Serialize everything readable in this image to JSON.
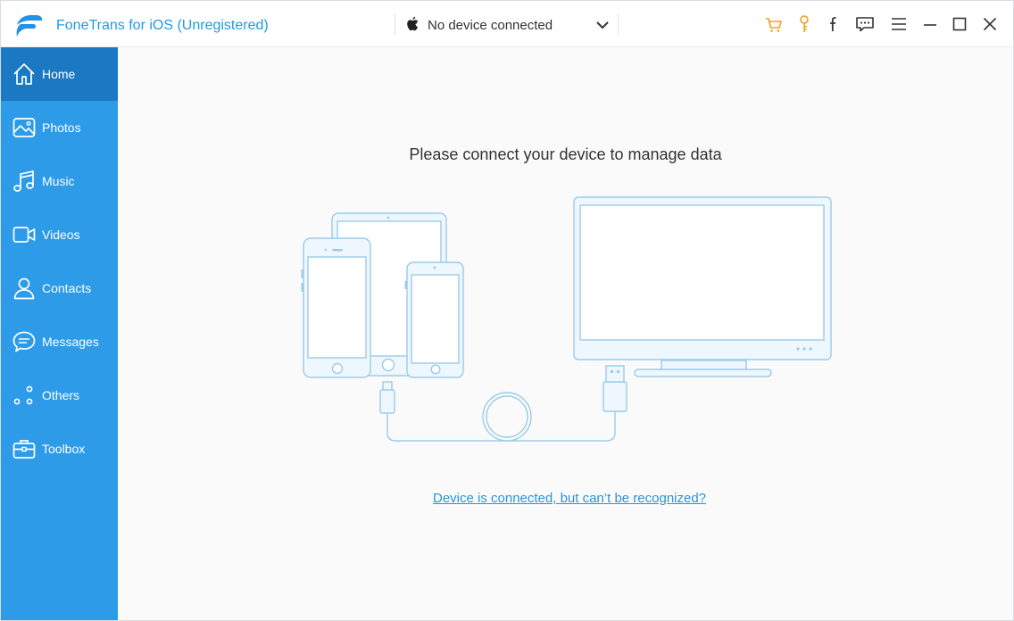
{
  "app": {
    "title": "FoneTrans for iOS (Unregistered)"
  },
  "device_selector": {
    "value": "No device connected"
  },
  "toolbar": {
    "icons": [
      "cart-icon",
      "key-icon",
      "facebook-icon",
      "feedback-icon",
      "menu-icon",
      "minimize-icon",
      "maximize-icon",
      "close-icon"
    ]
  },
  "sidebar": {
    "items": [
      {
        "label": "Home",
        "icon": "home-icon",
        "active": true
      },
      {
        "label": "Photos",
        "icon": "photos-icon"
      },
      {
        "label": "Music",
        "icon": "music-icon"
      },
      {
        "label": "Videos",
        "icon": "videos-icon"
      },
      {
        "label": "Contacts",
        "icon": "contacts-icon"
      },
      {
        "label": "Messages",
        "icon": "messages-icon"
      },
      {
        "label": "Others",
        "icon": "others-icon"
      },
      {
        "label": "Toolbox",
        "icon": "toolbox-icon"
      }
    ]
  },
  "main": {
    "headline": "Please connect your device to manage data",
    "help_link": "Device is connected, but can’t be recognized?"
  },
  "colors": {
    "accent": "#2d9be8",
    "sidebar_active": "#1b78c3",
    "toolbar_orange": "#f0a020",
    "illustration_stroke": "#9ccbe9",
    "illustration_fill": "#eaf5fc"
  }
}
